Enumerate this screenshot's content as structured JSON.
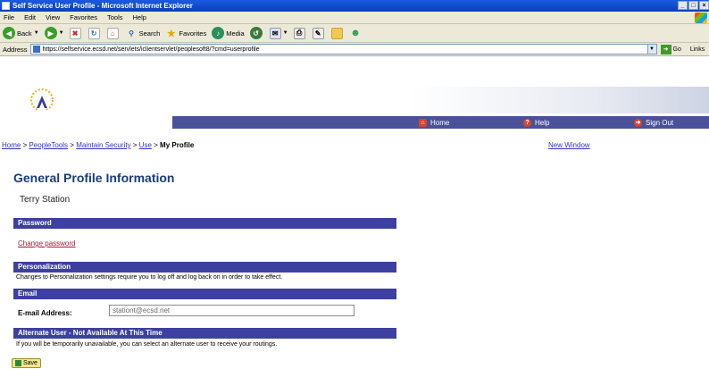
{
  "window": {
    "title": "Self Service User Profile - Microsoft Internet Explorer",
    "controls": [
      "_",
      "□",
      "×"
    ]
  },
  "menu": [
    "File",
    "Edit",
    "View",
    "Favorites",
    "Tools",
    "Help"
  ],
  "toolbar": {
    "back": "Back",
    "search": "Search",
    "favorites": "Favorites",
    "media": "Media"
  },
  "address": {
    "label": "Address",
    "url": "https://selfservice.ecsd.net/servlets/iclientservlet/peoplesoft8/?cmd=userprofile",
    "go": "Go",
    "links": "Links"
  },
  "nav": {
    "home": "Home",
    "help": "Help",
    "signout": "Sign Out"
  },
  "breadcrumb": {
    "home": "Home",
    "sep": " > ",
    "peopletools": "PeopleTools",
    "maintain": "Maintain Security",
    "use": "Use",
    "current": "My Profile"
  },
  "new_window": "New Window",
  "page_title": "General Profile Information",
  "user_name": "Terry Station",
  "password": {
    "header": "Password",
    "link": "Change password"
  },
  "personalization": {
    "header": "Personalization",
    "text": "Changes to Personalization settings require you to log off and log back on in order to take effect."
  },
  "email": {
    "header": "Email",
    "label": "E-mail Address:",
    "value": "stationt@ecsd.net"
  },
  "alternate": {
    "header": "Alternate User - Not Available At This Time",
    "text": "If you will be temporarily unavailable, you can select an alternate user to receive your routings."
  },
  "save_label": "Save"
}
